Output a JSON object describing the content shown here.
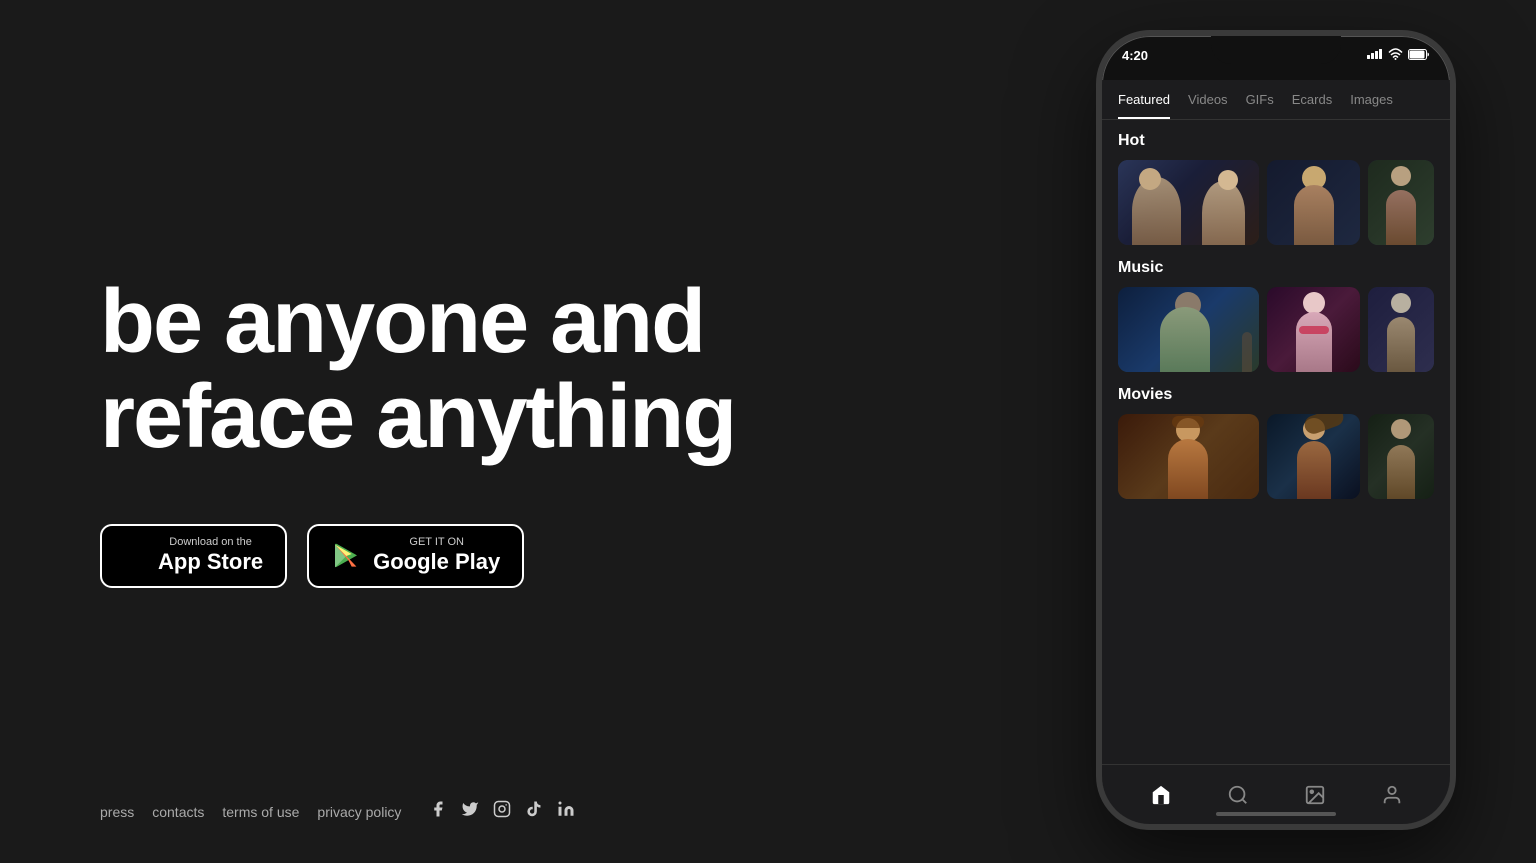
{
  "page": {
    "background": "#1a1a1a"
  },
  "headline": {
    "line1": "be anyone and",
    "line2": "reface anything"
  },
  "app_store_button": {
    "small_text": "Download on the",
    "large_text": "App Store"
  },
  "google_play_button": {
    "small_text": "GET IT ON",
    "large_text": "Google Play"
  },
  "footer": {
    "links": [
      "press",
      "contacts",
      "terms of use",
      "privacy policy"
    ]
  },
  "phone": {
    "status_bar": {
      "time": "4:20",
      "signal": "▋▋▋",
      "wifi": "wifi",
      "battery": "battery"
    },
    "tabs": [
      {
        "label": "Featured",
        "active": true
      },
      {
        "label": "Videos",
        "active": false
      },
      {
        "label": "GIFs",
        "active": false
      },
      {
        "label": "Ecards",
        "active": false
      },
      {
        "label": "Images",
        "active": false
      }
    ],
    "sections": [
      {
        "title": "Hot",
        "thumbnails": [
          "thumb-1",
          "thumb-2",
          "thumb-3"
        ]
      },
      {
        "title": "Music",
        "thumbnails": [
          "thumb-4",
          "thumb-5",
          "thumb-3"
        ]
      },
      {
        "title": "Movies",
        "thumbnails": [
          "thumb-6",
          "thumb-7",
          "thumb-8"
        ]
      }
    ],
    "bottom_nav": [
      "home",
      "search",
      "media",
      "profile"
    ]
  }
}
